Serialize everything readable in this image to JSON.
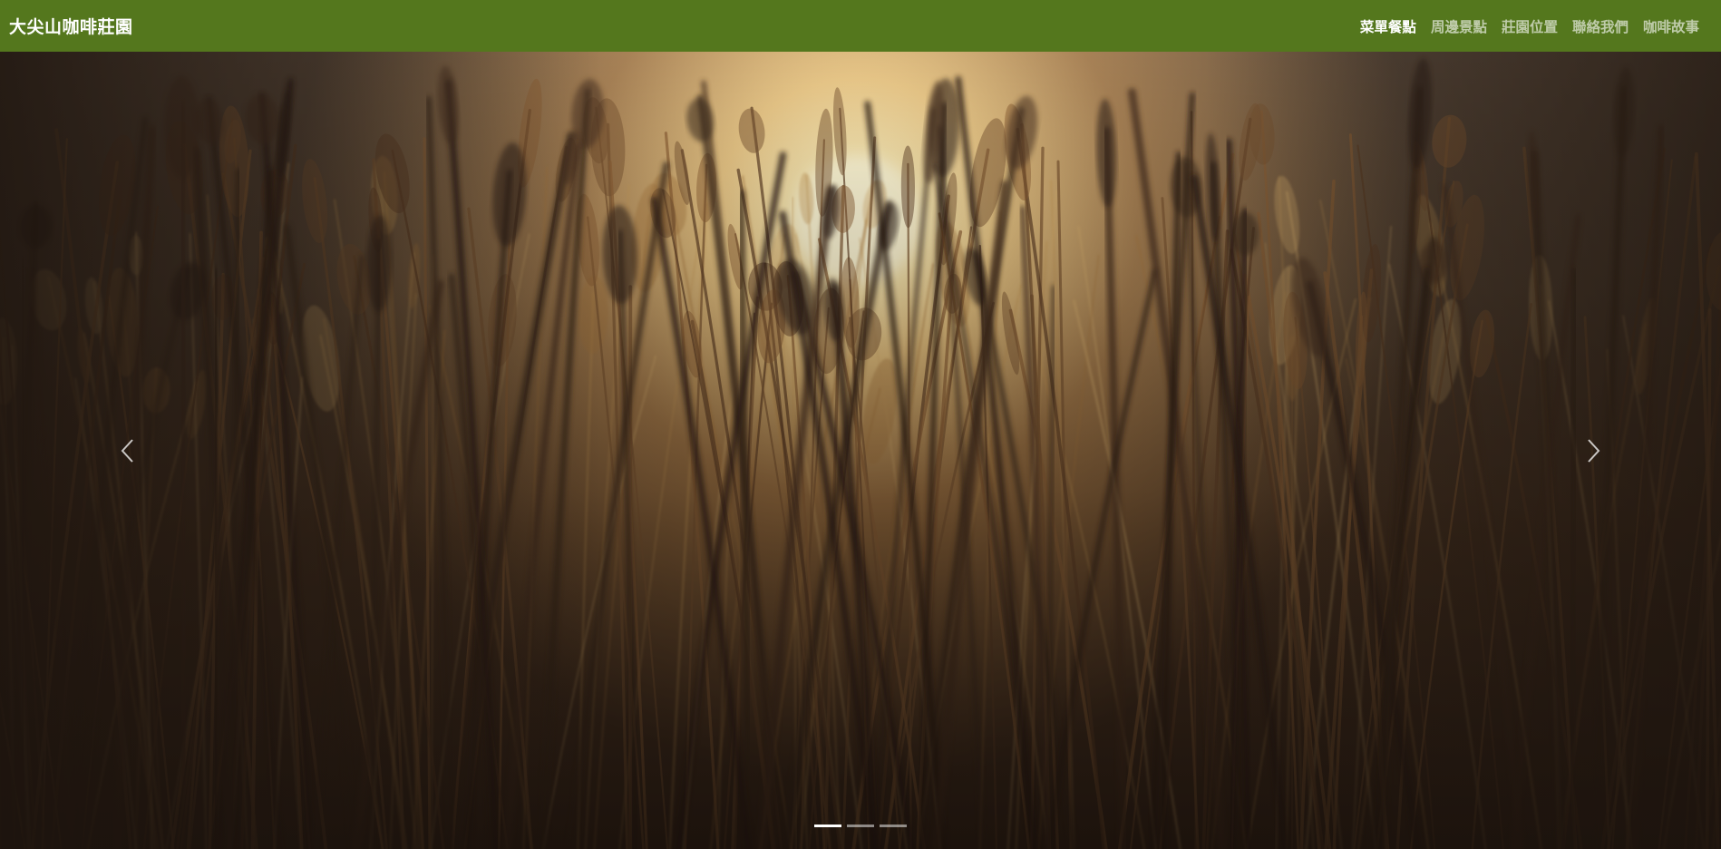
{
  "brand": {
    "name": "大尖山咖啡莊園"
  },
  "nav": {
    "items": [
      {
        "label": "菜單餐點",
        "active": true
      },
      {
        "label": "周邊景點",
        "active": false
      },
      {
        "label": "莊園位置",
        "active": false
      },
      {
        "label": "聯絡我們",
        "active": false
      },
      {
        "label": "咖啡故事",
        "active": false
      }
    ]
  },
  "carousel": {
    "prev_icon": "chevron-left-icon",
    "next_icon": "chevron-right-icon",
    "slide_count": 3,
    "active_index": 0
  },
  "colors": {
    "navbar": "#4d7114",
    "sky": "#f3ece0",
    "sun": "#fff1b8",
    "grass_dark": "#2c2018",
    "grass_mid": "#6b4c2c",
    "grass_light": "#b98a4a"
  }
}
